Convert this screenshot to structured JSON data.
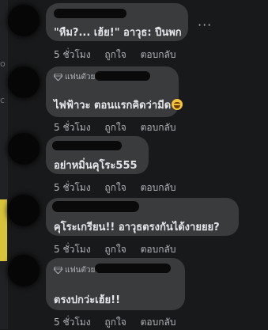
{
  "left_panel": {
    "labels": [
      "o",
      "c"
    ]
  },
  "comments": [
    {
      "text": "\"หืม?... เฮ้ย!\" อาวุธ: ปืนพก",
      "badge": "",
      "time": "5 ชั่วโมง",
      "like": "ถูกใจ",
      "reply": "ตอบกลับ",
      "more_icon": "more-horizontal-icon"
    },
    {
      "text": "ไฟฟ้าวะ ตอนแรกคิดว่ามีด",
      "emoji": "rolling-on-floor-laughing-icon",
      "badge": "แฟนตัวยง",
      "time": "5 ชั่วโมง",
      "like": "ถูกใจ",
      "reply": "ตอบกลับ"
    },
    {
      "text": "อย่าหมิ่นคุโระ555",
      "badge": "",
      "time": "5 ชั่วโมง",
      "like": "ถูกใจ",
      "reply": "ตอบกลับ"
    },
    {
      "text": "คุโระเกรียน!! อาวุธตรงกันได้งายยย?",
      "badge": "",
      "time": "5 ชั่วโมง",
      "like": "ถูกใจ",
      "reply": "ตอบกลับ"
    },
    {
      "text": "ตรงปกว่ะเฮ้ย!!",
      "badge": "แฟนตัวยง",
      "time": "5 ชั่วโมง",
      "like": "ถูกใจ",
      "reply": "ตอบกลับ"
    }
  ],
  "colors": {
    "background": "#18191a",
    "bubble": "#3a3b3c",
    "text": "#e4e6eb",
    "meta": "#b0b3b8"
  }
}
